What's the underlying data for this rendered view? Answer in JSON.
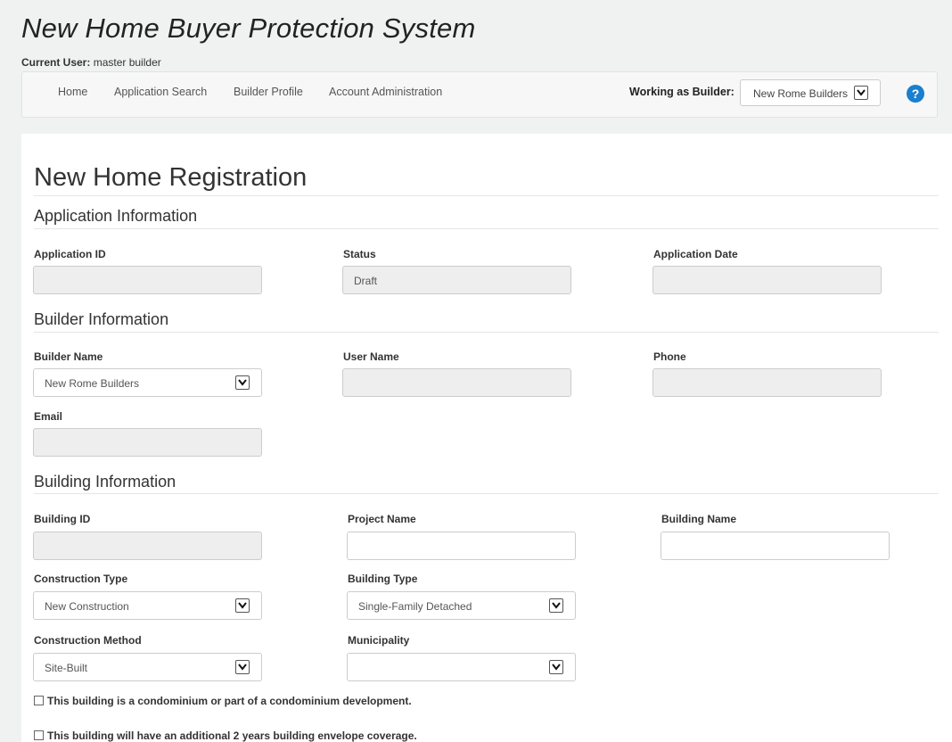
{
  "header": {
    "app_title": "New Home Buyer Protection System",
    "current_user_label": "Current User:",
    "current_user_value": "master builder"
  },
  "nav": {
    "items": [
      "Home",
      "Application Search",
      "Builder Profile",
      "Account Administration"
    ],
    "working_as_label": "Working as Builder:",
    "working_as_value": "New Rome Builders",
    "help_icon": "?"
  },
  "form": {
    "title": "New Home Registration",
    "application": {
      "heading": "Application Information",
      "application_id_label": "Application ID",
      "application_id_value": "",
      "status_label": "Status",
      "status_value": "Draft",
      "application_date_label": "Application Date",
      "application_date_value": ""
    },
    "builder": {
      "heading": "Builder Information",
      "builder_name_label": "Builder Name",
      "builder_name_value": "New Rome Builders",
      "user_name_label": "User Name",
      "user_name_value": "",
      "phone_label": "Phone",
      "phone_value": "",
      "email_label": "Email",
      "email_value": ""
    },
    "building": {
      "heading": "Building Information",
      "building_id_label": "Building ID",
      "building_id_value": "",
      "project_name_label": "Project Name",
      "project_name_value": "",
      "building_name_label": "Building Name",
      "building_name_value": "",
      "construction_type_label": "Construction Type",
      "construction_type_value": "New Construction",
      "building_type_label": "Building Type",
      "building_type_value": "Single-Family Detached",
      "construction_method_label": "Construction Method",
      "construction_method_value": "Site-Built",
      "municipality_label": "Municipality",
      "municipality_value": "",
      "condo_checkbox_label": "This building is a condominium or part of a condominium development.",
      "envelope_checkbox_label": "This building will have an additional 2 years building envelope coverage."
    }
  },
  "colors": {
    "page_bg": "#f0f1f1",
    "help_icon": "#1a7fcf",
    "readonly_field": "#eeeeee"
  }
}
